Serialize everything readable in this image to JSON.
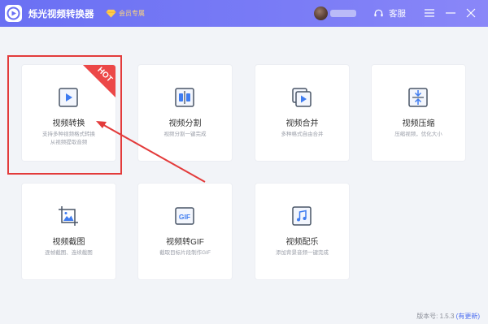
{
  "app": {
    "title": "烁光视频转换器",
    "vip_label": "会员专属"
  },
  "header": {
    "service_label": "客服"
  },
  "cards": [
    {
      "title": "视频转换",
      "desc": [
        "支持多种视频格式转换",
        "从视频提取音频"
      ],
      "badge": "HOT",
      "icon": "video-play-icon"
    },
    {
      "title": "视频分割",
      "desc": [
        "视频分割一键完成"
      ],
      "icon": "split-icon"
    },
    {
      "title": "视频合并",
      "desc": [
        "多种格式自由合并"
      ],
      "icon": "merge-icon"
    },
    {
      "title": "视频压缩",
      "desc": [
        "压缩视频，优化大小"
      ],
      "icon": "compress-icon"
    },
    {
      "title": "视频截图",
      "desc": [
        "逐帧截图、连续截图"
      ],
      "icon": "screenshot-icon"
    },
    {
      "title": "视频转GIF",
      "desc": [
        "截取目标片段制作GIF"
      ],
      "icon": "gif-icon",
      "icon_text": "GIF"
    },
    {
      "title": "视频配乐",
      "desc": [
        "添加背景音频一键完成"
      ],
      "icon": "music-icon"
    }
  ],
  "footer": {
    "version": "版本号: 1.5.3",
    "update": "(有更新)"
  },
  "colors": {
    "titlebar": "#6f73f4",
    "accent": "#4b6cf0",
    "highlight": "#e33b3b",
    "hot_ribbon": "#ec4848"
  }
}
